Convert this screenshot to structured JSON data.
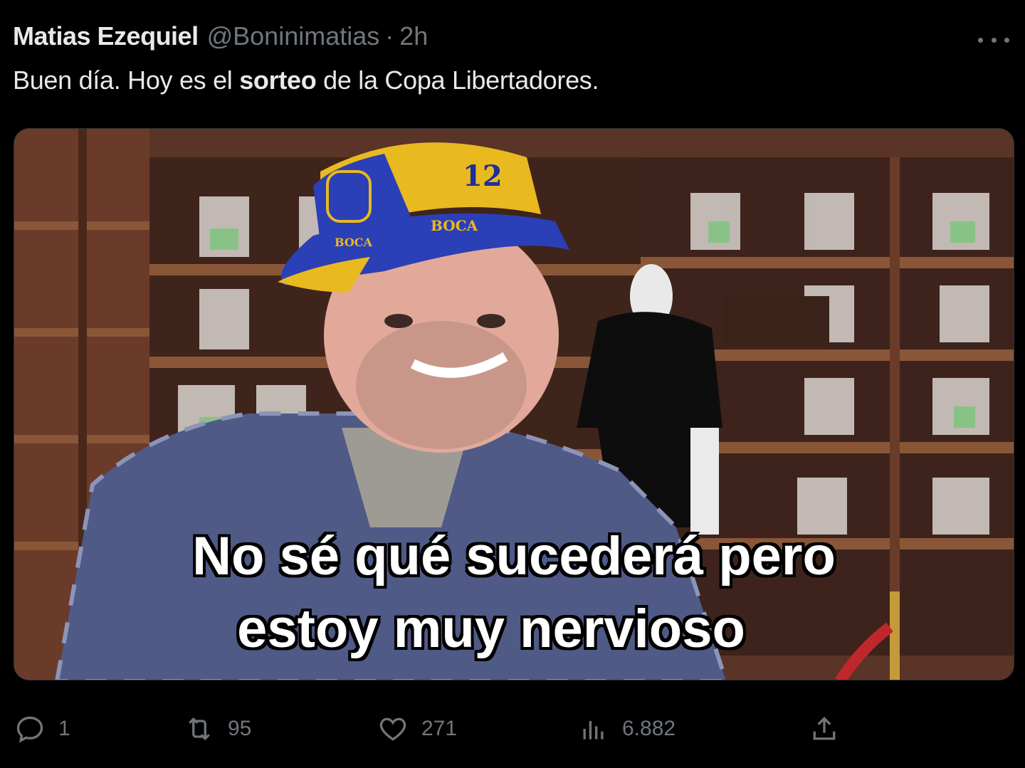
{
  "tweet": {
    "author_name": "Matias Ezequiel",
    "handle": "@Boninimatias",
    "separator": "·",
    "time": "2h",
    "text_before": "Buen día. Hoy es el ",
    "text_bold": "sorteo",
    "text_after": " de la Copa Libertadores.",
    "more_icon": "more-horizontal-icon"
  },
  "media": {
    "caption_line1": "No sé qué sucederá pero",
    "caption_line2": "estoy muy nervioso",
    "hat_number": "12",
    "hat_text": "BOCA",
    "hat_brim_text": "BOCA",
    "colors": {
      "hat_yellow": "#e9b920",
      "hat_blue": "#2b3fb6",
      "shelf_wood": "#6e3f2c"
    }
  },
  "actions": {
    "reply": {
      "icon": "reply-icon",
      "count": "1"
    },
    "retweet": {
      "icon": "retweet-icon",
      "count": "95"
    },
    "like": {
      "icon": "heart-icon",
      "count": "271"
    },
    "views": {
      "icon": "analytics-icon",
      "count": "6.882"
    },
    "share": {
      "icon": "share-icon"
    }
  }
}
